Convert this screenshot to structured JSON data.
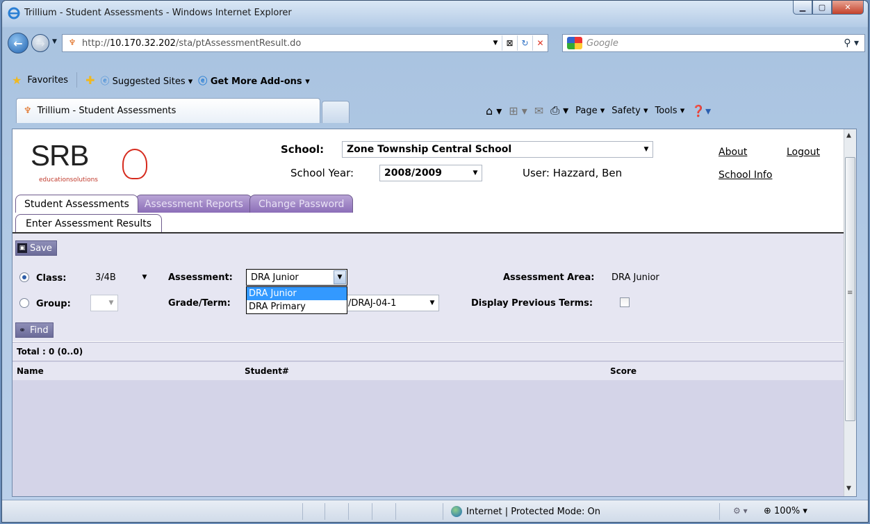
{
  "window": {
    "title": "Trillium - Student Assessments - Windows Internet Explorer"
  },
  "nav": {
    "url_prefix": "http://",
    "url_host": "10.170.32.202",
    "url_path": "/sta/ptAssessmentResult.do",
    "search_placeholder": "Google"
  },
  "favorites": {
    "favorites_label": "Favorites",
    "suggested_label": "Suggested Sites ▾",
    "addons_label": "Get More Add-ons ▾"
  },
  "tab": {
    "title": "Trillium - Student Assessments"
  },
  "commands": {
    "page": "Page ▾",
    "safety": "Safety ▾",
    "tools": "Tools ▾"
  },
  "header": {
    "logo_text": "SRB",
    "logo_sub": "educationsolutions",
    "school_label": "School:",
    "school_value": "Zone Township Central School",
    "year_label": "School Year:",
    "year_value": "2008/2009",
    "user_text": "User: Hazzard, Ben",
    "about_link": "About",
    "logout_link": "Logout",
    "schoolinfo_link": "School Info"
  },
  "app_tabs": [
    "Student Assessments",
    "Assessment Reports",
    "Change Password"
  ],
  "sub_tabs": [
    "Enter Assessment Results"
  ],
  "form": {
    "save_label": "Save",
    "class_label": "Class:",
    "class_value": "3/4B",
    "group_label": "Group:",
    "assessment_label": "Assessment:",
    "assessment_value": "DRA Junior",
    "assessment_options": [
      "DRA Junior",
      "DRA Primary"
    ],
    "gradeterm_label": "Grade/Term:",
    "gradeterm_value": "/DRAJ-04-1",
    "area_label": "Assessment Area:",
    "area_value": "DRA Junior",
    "prev_terms_label": "Display Previous Terms:",
    "find_label": "Find"
  },
  "grid": {
    "total": "Total : 0 (0..0)",
    "columns": [
      "Name",
      "Student#",
      "Score"
    ]
  },
  "status": {
    "zone": "Internet | Protected Mode: On",
    "zoom": "100%"
  }
}
